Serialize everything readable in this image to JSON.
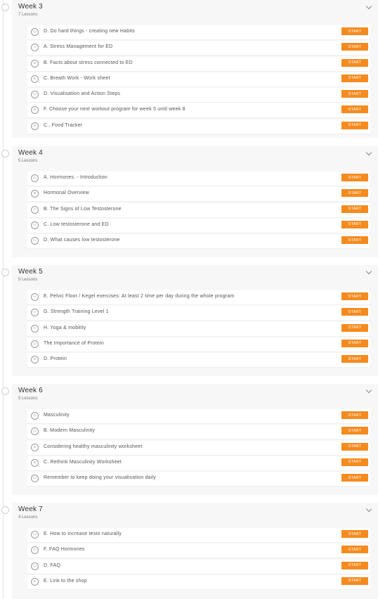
{
  "start_label": "START",
  "colors": {
    "accent": "#f58b1f",
    "card": "#f7f7f7"
  },
  "modules": [
    {
      "title": "Week 3",
      "count": "7 Lessons",
      "lessons": [
        {
          "title": "D. Do hard things - creating new Habits",
          "icon": "video-icon"
        },
        {
          "title": "A. Stress Management for ED",
          "icon": "code-icon"
        },
        {
          "title": "B. Facts about stress connected to ED",
          "icon": "document-icon"
        },
        {
          "title": "C. Breath Work - Work sheet",
          "icon": "document-icon"
        },
        {
          "title": "D. Visualisation and Action Steps",
          "icon": "video-icon"
        },
        {
          "title": "F. Choose your next workout program for week 5 until week 8",
          "icon": "document-icon"
        },
        {
          "title": "C.. Food Tracker",
          "icon": "document-icon"
        }
      ]
    },
    {
      "title": "Week 4",
      "count": "5 Lessons",
      "lessons": [
        {
          "title": "A. Hormones. - Introduction",
          "icon": "video-icon"
        },
        {
          "title": "Hormonal Overview",
          "icon": "document-icon"
        },
        {
          "title": "B. The Signs of Low Testosterone",
          "icon": "video-icon"
        },
        {
          "title": "C. Low testosterone and ED",
          "icon": "video-icon"
        },
        {
          "title": "D. What causes low testosterone",
          "icon": "video-icon"
        }
      ]
    },
    {
      "title": "Week 5",
      "count": "5 Lessons",
      "lessons": [
        {
          "title": "E. Pelvic Floor / Kegel exercises: At least 2 time per day during the whole program",
          "icon": "code-icon"
        },
        {
          "title": "G. Strength Training Level 1",
          "icon": "code-icon"
        },
        {
          "title": "H. Yoga & mobility",
          "icon": "code-icon"
        },
        {
          "title": "The Importance of Protein",
          "icon": "video-icon"
        },
        {
          "title": "D. Protein",
          "icon": "document-icon"
        }
      ]
    },
    {
      "title": "Week 6",
      "count": "5 Lessons",
      "lessons": [
        {
          "title": "Masculinity",
          "icon": "video-icon"
        },
        {
          "title": "B. Modern Masculinity",
          "icon": "video-icon"
        },
        {
          "title": "Considering healthy masculinity worksheet",
          "icon": "document-icon"
        },
        {
          "title": "C. Rethink Masculinity Worksheet",
          "icon": "document-icon"
        },
        {
          "title": "Remember to keep doing your visualisation daily",
          "icon": "video-icon"
        }
      ]
    },
    {
      "title": "Week 7",
      "count": "4 Lessons",
      "lessons": [
        {
          "title": "E. How to increase testo naturally",
          "icon": "video-icon"
        },
        {
          "title": "F. FAQ Hormones",
          "icon": "video-icon"
        },
        {
          "title": "D. FAQ",
          "icon": "video-icon"
        },
        {
          "title": "E. Link to the shop",
          "icon": "document-icon"
        }
      ]
    }
  ]
}
